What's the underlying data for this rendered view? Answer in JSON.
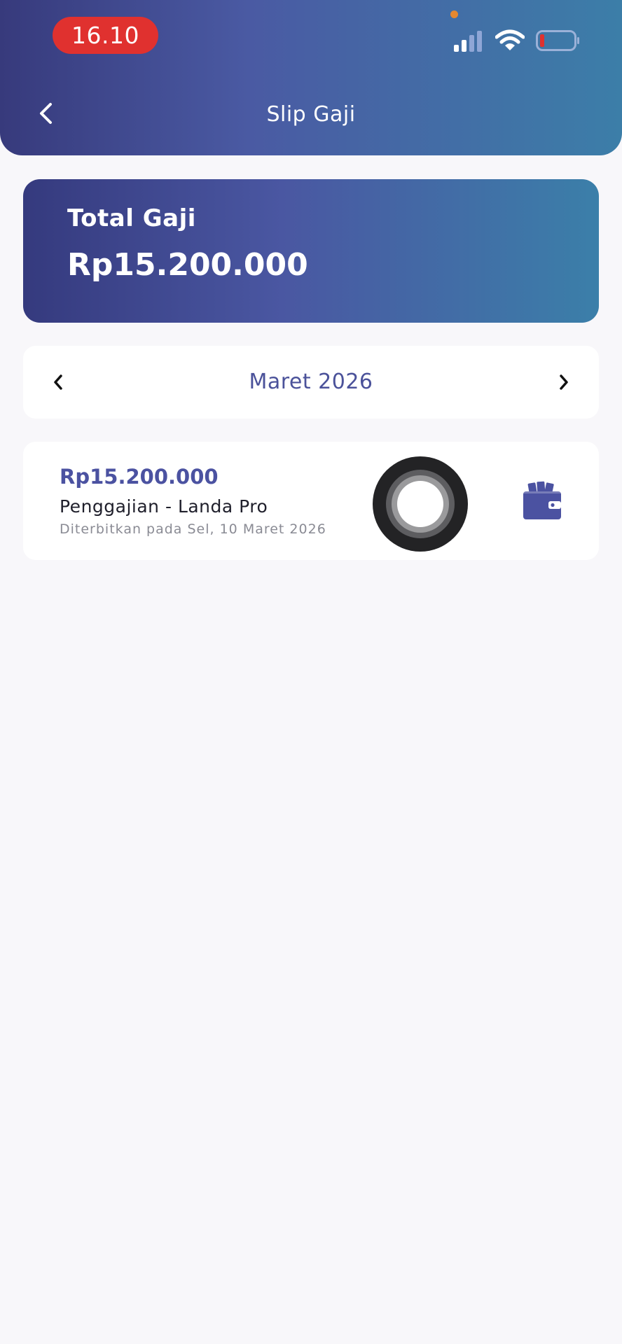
{
  "status_bar": {
    "time": "16.10"
  },
  "header": {
    "title": "Slip Gaji"
  },
  "summary": {
    "label": "Total Gaji",
    "amount": "Rp15.200.000"
  },
  "month_selector": {
    "label": "Maret 2026"
  },
  "slips": [
    {
      "amount": "Rp15.200.000",
      "title": "Penggajian - Landa Pro",
      "issued": "Diterbitkan pada Sel, 10 Maret 2026"
    }
  ],
  "icons": {
    "back": "chevron-left-icon",
    "prev": "chevron-left-icon",
    "next": "chevron-right-icon",
    "slip": "wallet-icon"
  },
  "colors": {
    "accent": "#4b52a1",
    "time_pill": "#e0312f",
    "battery_low": "#e0312f",
    "header_gradient_start": "#373a7c",
    "header_gradient_end": "#3c7ea8"
  }
}
